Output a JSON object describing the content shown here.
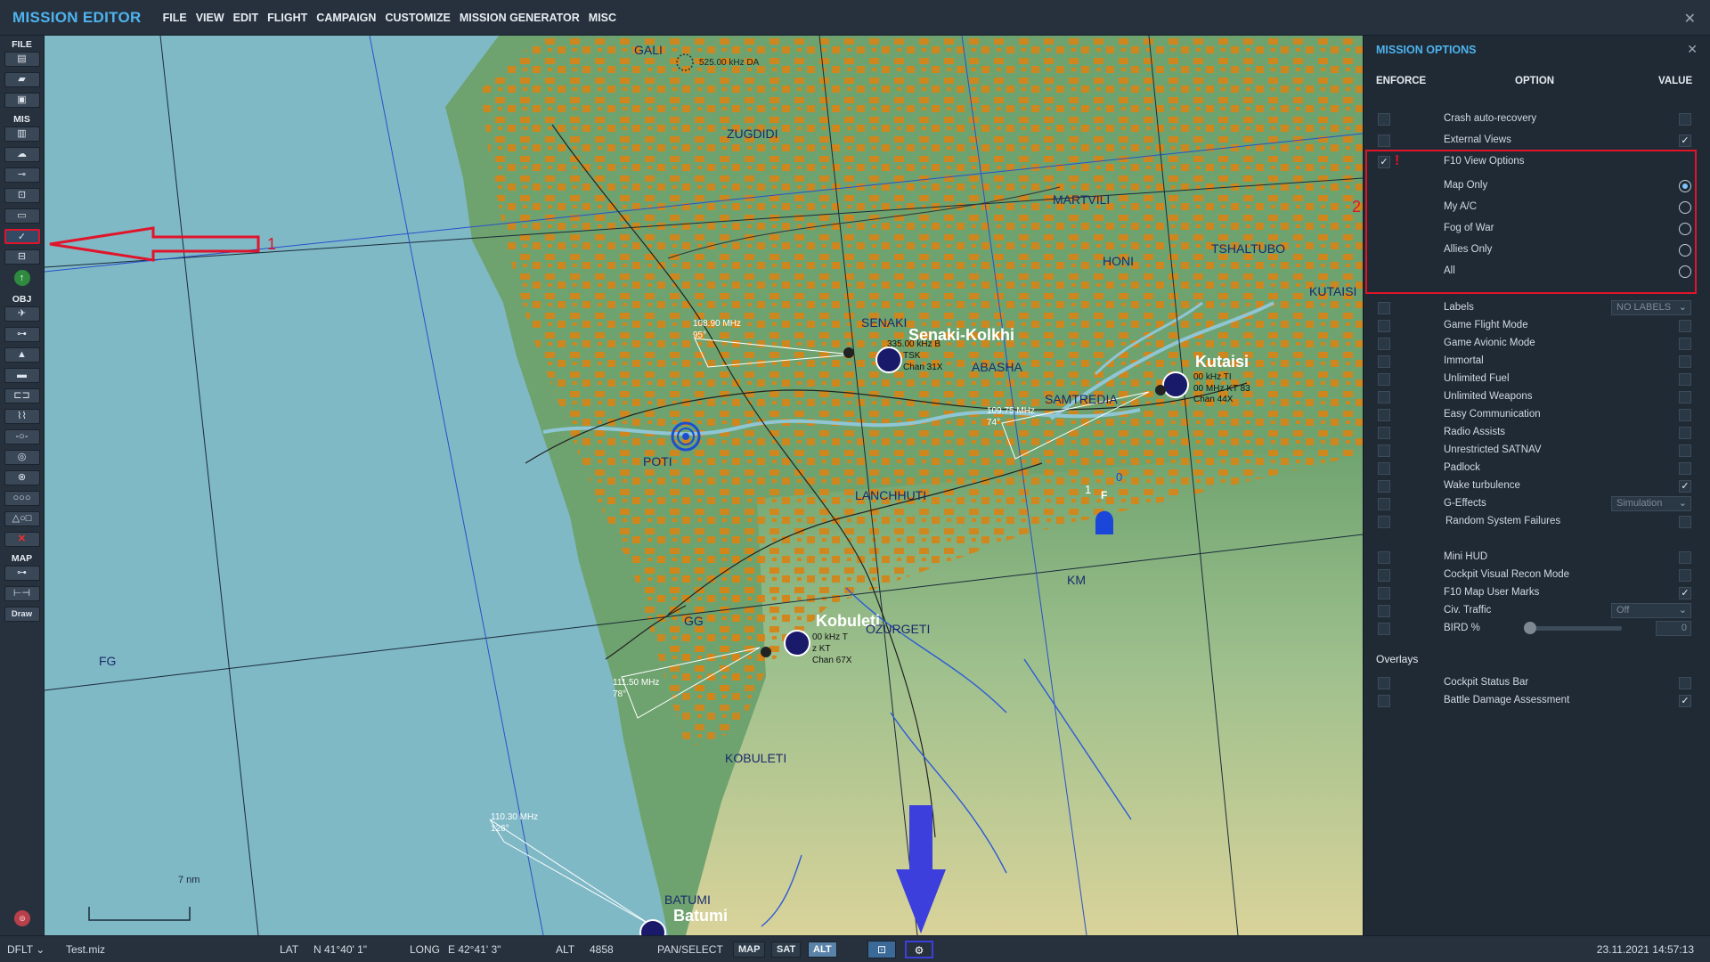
{
  "app": {
    "title": "MISSION EDITOR",
    "close_icon": "close-icon"
  },
  "menu": [
    "FILE",
    "VIEW",
    "EDIT",
    "FLIGHT",
    "CAMPAIGN",
    "CUSTOMIZE",
    "MISSION GENERATOR",
    "MISC"
  ],
  "toolbar": {
    "file_label": "FILE",
    "mis_label": "MIS",
    "obj_label": "OBJ",
    "map_label": "MAP",
    "draw_label": "Draw"
  },
  "annotations": {
    "n1": "1",
    "n2": "2",
    "excl": "!"
  },
  "map_labels": {
    "gali": "GALI",
    "gali_freq": "525.00 kHz DA",
    "zugdidi": "ZUGDIDI",
    "martvili": "MARTVILI",
    "honi": "HONI",
    "tshaltubo": "TSHALTUBO",
    "kutaisi_town": "KUTAISI",
    "senaki": "SENAKI",
    "senaki_kolkhi": "Senaki-Kolkhi",
    "abasha": "ABASHA",
    "kutaisi_ab": "Kutaisi",
    "samtredia": "SAMTREDIA",
    "poti": "POTI",
    "lanchhuti": "LANCHHUTI",
    "km": "KM",
    "gg": "GG",
    "fg": "FG",
    "kobuleti_ab": "Kobuleti",
    "ozurgeti": "OZURGETI",
    "kobuleti_town": "KOBULETI",
    "batumi_town": "BATUMI",
    "batumi_ab": "Batumi",
    "ils1_freq": "108.90 MHz",
    "ils1_course": "95°",
    "ils2_freq": "109.75 MHz",
    "ils2_course": "74°",
    "ils3_freq": "111.50 MHz",
    "ils3_course": "78°",
    "ils4_freq": "110.30 MHz",
    "ils4_course": "126°",
    "senaki_ndb": "335.00 kHz B",
    "senaki_tsk": "TSK",
    "senaki_chan": "Chan 31X",
    "kutaisi_ndb": "00 kHz TI",
    "kutaisi_kt": "00 MHz KT 83",
    "kutaisi_chan": "Chan 44X",
    "kobuleti_ndb": "00 kHz T",
    "kobuleti_kt": "z KT",
    "kobuleti_chan": "Chan 67X",
    "scale": "7 nm",
    "unit_num": "1",
    "unit_zero": "0",
    "unit_letter": "F"
  },
  "panel": {
    "title": "MISSION OPTIONS",
    "col_enforce": "ENFORCE",
    "col_option": "OPTION",
    "col_value": "VALUE",
    "overlays_label": "Overlays",
    "rows": [
      {
        "label": "Crash auto-recovery",
        "enforce": false,
        "value": false
      },
      {
        "label": "External Views",
        "enforce": false,
        "value": true
      },
      {
        "label": "F10 View Options",
        "enforce": true,
        "value": null
      },
      {
        "label": "Map Only",
        "radio": true,
        "selected": true
      },
      {
        "label": "My A/C",
        "radio": true,
        "selected": false
      },
      {
        "label": "Fog of War",
        "radio": true,
        "selected": false
      },
      {
        "label": "Allies Only",
        "radio": true,
        "selected": false
      },
      {
        "label": "All",
        "radio": true,
        "selected": false
      },
      {
        "label": "Labels",
        "enforce": false,
        "dropdown": "NO LABELS"
      },
      {
        "label": "Game Flight Mode",
        "enforce": false,
        "value": false
      },
      {
        "label": "Game Avionic Mode",
        "enforce": false,
        "value": false
      },
      {
        "label": "Immortal",
        "enforce": false,
        "value": false
      },
      {
        "label": "Unlimited Fuel",
        "enforce": false,
        "value": false
      },
      {
        "label": "Unlimited Weapons",
        "enforce": false,
        "value": false
      },
      {
        "label": "Easy Communication",
        "enforce": false,
        "value": false
      },
      {
        "label": "Radio Assists",
        "enforce": false,
        "value": false
      },
      {
        "label": "Unrestricted SATNAV",
        "enforce": false,
        "value": false
      },
      {
        "label": "Padlock",
        "enforce": false,
        "value": false
      },
      {
        "label": "Wake turbulence",
        "enforce": false,
        "value": true
      },
      {
        "label": "G-Effects",
        "enforce": false,
        "dropdown": "Simulation"
      },
      {
        "label": "Random System Failures",
        "enforce": false,
        "value": false
      },
      {
        "label": "Mini HUD",
        "enforce": false,
        "value": false
      },
      {
        "label": "Cockpit Visual Recon Mode",
        "enforce": false,
        "value": false
      },
      {
        "label": "F10 Map User Marks",
        "enforce": false,
        "value": true
      },
      {
        "label": "Civ. Traffic",
        "enforce": false,
        "dropdown": "Off"
      },
      {
        "label": "BIRD %",
        "enforce": false,
        "slider": 0,
        "number": "0"
      },
      {
        "label": "Cockpit Status Bar",
        "enforce": false,
        "value": false
      },
      {
        "label": "Battle Damage Assessment",
        "enforce": false,
        "value": true
      }
    ]
  },
  "status": {
    "profile": "DFLT",
    "file": "Test.miz",
    "lat_label": "LAT",
    "lat_value": "N 41°40' 1\"",
    "long_label": "LONG",
    "long_value": "E 42°41' 3\"",
    "alt_label": "ALT",
    "alt_value": "4858",
    "mode": "PAN/SELECT",
    "btn_map": "MAP",
    "btn_sat": "SAT",
    "btn_alt": "ALT",
    "datetime": "23.11.2021 14:57:13"
  },
  "colors": {
    "accent": "#4fb3ee",
    "highlight": "#e0142b",
    "pointer": "#3c3fdc",
    "sea": "#7fb9c6",
    "land": "#6ea36f",
    "urban": "#d2861a"
  }
}
